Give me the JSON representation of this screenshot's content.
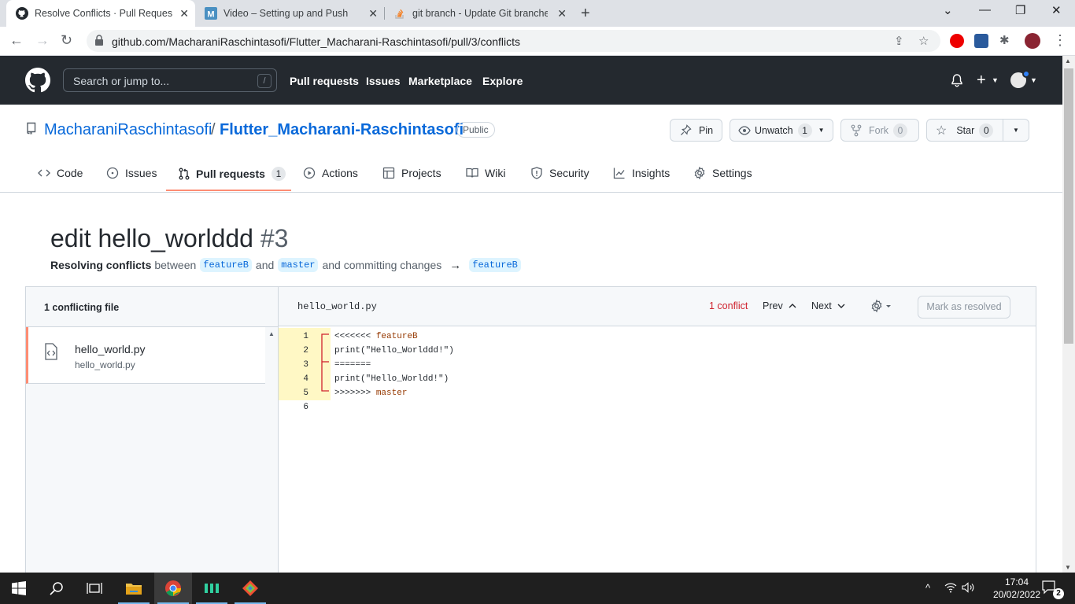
{
  "browser": {
    "tabs": [
      {
        "title": "Resolve Conflicts · Pull Request #",
        "active": true
      },
      {
        "title": "Video – Setting up and Push",
        "active": false
      },
      {
        "title": "git branch - Update Git branches",
        "active": false
      }
    ],
    "url": "github.com/MacharaniRaschintasofi/Flutter_Macharani-Raschintasofi/pull/3/conflicts"
  },
  "github_header": {
    "search_placeholder": "Search or jump to...",
    "search_shortcut": "/",
    "nav": [
      "Pull requests",
      "Issues",
      "Marketplace",
      "Explore"
    ]
  },
  "repo": {
    "owner": "MacharaniRaschintasofi",
    "separator": "/",
    "name": "Flutter_Macharani-Raschintasofi",
    "visibility": "Public",
    "pin_label": "Pin",
    "unwatch_label": "Unwatch",
    "unwatch_count": "1",
    "fork_label": "Fork",
    "fork_count": "0",
    "star_label": "Star",
    "star_count": "0",
    "tabs": [
      {
        "label": "Code"
      },
      {
        "label": "Issues"
      },
      {
        "label": "Pull requests",
        "count": "1"
      },
      {
        "label": "Actions"
      },
      {
        "label": "Projects"
      },
      {
        "label": "Wiki"
      },
      {
        "label": "Security"
      },
      {
        "label": "Insights"
      },
      {
        "label": "Settings"
      }
    ]
  },
  "pr": {
    "title": "edit hello_worlddd",
    "number": "#3",
    "resolving_bold": "Resolving conflicts",
    "between": "between",
    "head_branch": "featureB",
    "and": "and",
    "base_branch": "master",
    "and_committing": "and committing changes",
    "target_branch": "featureB"
  },
  "conflict_panel": {
    "sidebar_header": "1 conflicting file",
    "file": {
      "name": "hello_world.py",
      "path": "hello_world.py"
    },
    "editor_filename": "hello_world.py",
    "conflict_count": "1 conflict",
    "prev_label": "Prev",
    "next_label": "Next",
    "mark_resolved_label": "Mark as resolved",
    "code_lines": [
      {
        "n": "1",
        "marker": "<<<<<<<",
        "rest": " featureB"
      },
      {
        "n": "2",
        "text": "print(\"Hello_Worlddd!\")"
      },
      {
        "n": "3",
        "text": "======="
      },
      {
        "n": "4",
        "text": "print(\"Hello_Worldd!\")"
      },
      {
        "n": "5",
        "marker": ">>>>>>>",
        "rest": " master"
      },
      {
        "n": "6",
        "text": ""
      }
    ]
  },
  "taskbar": {
    "time": "17:04",
    "date": "20/02/2022",
    "notification_count": "2"
  }
}
